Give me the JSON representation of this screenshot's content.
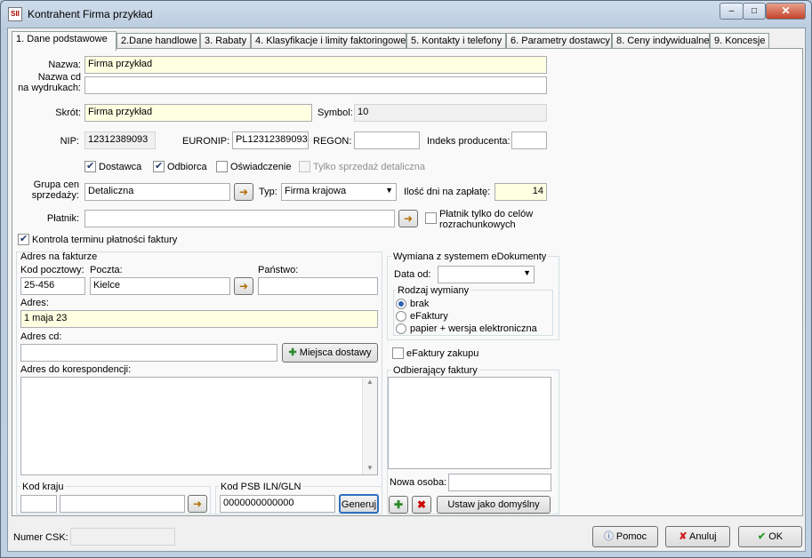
{
  "window": {
    "title": "Kontrahent Firma przykład",
    "controls": {
      "minimize": "–",
      "maximize": "□",
      "close": "✕"
    }
  },
  "tabs": [
    "1. Dane podstawowe",
    "2.Dane handlowe",
    "3. Rabaty",
    "4. Klasyfikacje i limity faktoringowe",
    "5. Kontakty i telefony",
    "6. Parametry dostawcy",
    "8. Ceny indywidualne",
    "9. Koncesje"
  ],
  "form": {
    "nazwa_label": "Nazwa:",
    "nazwa_value": "Firma przykład",
    "nazwa_cd_label1": "Nazwa cd",
    "nazwa_cd_label2": "na wydrukach:",
    "nazwa_cd_value": "",
    "skrot_label": "Skrót:",
    "skrot_value": "Firma przykład",
    "symbol_label": "Symbol:",
    "symbol_value": "10",
    "nip_label": "NIP:",
    "nip_value": "12312389093",
    "euronip_label": "EURONIP:",
    "euronip_value": "PL12312389093",
    "regon_label": "REGON:",
    "regon_value": "",
    "indeks_label": "Indeks producenta:",
    "indeks_value": "",
    "dostawca_label": "Dostawca",
    "odbiorca_label": "Odbiorca",
    "oswiadczenie_label": "Oświadczenie",
    "tylko_sprzedaz_label": "Tylko sprzedaż detaliczna",
    "grupa_label1": "Grupa cen",
    "grupa_label2": "sprzedaży:",
    "grupa_value": "Detaliczna",
    "typ_label": "Typ:",
    "typ_value": "Firma krajowa",
    "ilosc_dni_label": "Ilość dni na zapłatę:",
    "ilosc_dni_value": "14",
    "platnik_label": "Płatnik:",
    "platnik_value": "",
    "platnik_cele_label1": "Płatnik tylko do celów",
    "platnik_cele_label2": "rozrachunkowych",
    "kontrola_label": "Kontrola terminu płatności faktury"
  },
  "adres": {
    "group_title": "Adres na fakturze",
    "kod_label": "Kod pocztowy:",
    "kod_value": "25-456",
    "poczta_label": "Poczta:",
    "poczta_value": "Kielce",
    "panstwo_label": "Państwo:",
    "panstwo_value": "",
    "adres_label": "Adres:",
    "adres_value": "1 maja 23",
    "adres_cd_label": "Adres cd:",
    "adres_cd_value": "",
    "miejsca_button": "Miejsca dostawy",
    "korespondencja_label": "Adres do korespondencji:",
    "korespondencja_value": ""
  },
  "kod_kraju": {
    "label": "Kod kraju",
    "value1": "",
    "value2": ""
  },
  "kod_psb": {
    "label": "Kod PSB ILN/GLN",
    "value": "0000000000000",
    "generuj_button": "Generuj"
  },
  "edokumenty": {
    "title": "Wymiana z systemem eDokumenty",
    "data_od_label": "Data od:",
    "data_od_value": "",
    "rodzaj_title": "Rodzaj wymiany",
    "options": [
      "brak",
      "eFaktury",
      "papier + wersja elektroniczna"
    ]
  },
  "efaktury_zakupu_label": "eFaktury zakupu",
  "odbiorajacy": {
    "title": "Odbierający faktury",
    "nowa_osoba_label": "Nowa osoba:",
    "nowa_osoba_value": "",
    "ustaw_button": "Ustaw jako domyślny"
  },
  "bottom": {
    "numer_csk_label": "Numer CSK:",
    "numer_csk_value": "",
    "pomoc_button": "Pomoc",
    "anuluj_button": "Anuluj",
    "ok_button": "OK"
  }
}
